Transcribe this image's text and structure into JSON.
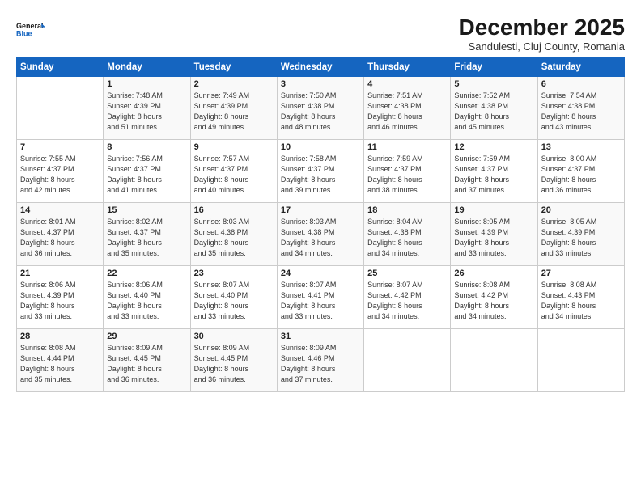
{
  "header": {
    "logo_line1": "General",
    "logo_line2": "Blue",
    "month": "December 2025",
    "location": "Sandulesti, Cluj County, Romania"
  },
  "days_of_week": [
    "Sunday",
    "Monday",
    "Tuesday",
    "Wednesday",
    "Thursday",
    "Friday",
    "Saturday"
  ],
  "weeks": [
    [
      {
        "day": "",
        "info": ""
      },
      {
        "day": "1",
        "info": "Sunrise: 7:48 AM\nSunset: 4:39 PM\nDaylight: 8 hours\nand 51 minutes."
      },
      {
        "day": "2",
        "info": "Sunrise: 7:49 AM\nSunset: 4:39 PM\nDaylight: 8 hours\nand 49 minutes."
      },
      {
        "day": "3",
        "info": "Sunrise: 7:50 AM\nSunset: 4:38 PM\nDaylight: 8 hours\nand 48 minutes."
      },
      {
        "day": "4",
        "info": "Sunrise: 7:51 AM\nSunset: 4:38 PM\nDaylight: 8 hours\nand 46 minutes."
      },
      {
        "day": "5",
        "info": "Sunrise: 7:52 AM\nSunset: 4:38 PM\nDaylight: 8 hours\nand 45 minutes."
      },
      {
        "day": "6",
        "info": "Sunrise: 7:54 AM\nSunset: 4:38 PM\nDaylight: 8 hours\nand 43 minutes."
      }
    ],
    [
      {
        "day": "7",
        "info": "Sunrise: 7:55 AM\nSunset: 4:37 PM\nDaylight: 8 hours\nand 42 minutes."
      },
      {
        "day": "8",
        "info": "Sunrise: 7:56 AM\nSunset: 4:37 PM\nDaylight: 8 hours\nand 41 minutes."
      },
      {
        "day": "9",
        "info": "Sunrise: 7:57 AM\nSunset: 4:37 PM\nDaylight: 8 hours\nand 40 minutes."
      },
      {
        "day": "10",
        "info": "Sunrise: 7:58 AM\nSunset: 4:37 PM\nDaylight: 8 hours\nand 39 minutes."
      },
      {
        "day": "11",
        "info": "Sunrise: 7:59 AM\nSunset: 4:37 PM\nDaylight: 8 hours\nand 38 minutes."
      },
      {
        "day": "12",
        "info": "Sunrise: 7:59 AM\nSunset: 4:37 PM\nDaylight: 8 hours\nand 37 minutes."
      },
      {
        "day": "13",
        "info": "Sunrise: 8:00 AM\nSunset: 4:37 PM\nDaylight: 8 hours\nand 36 minutes."
      }
    ],
    [
      {
        "day": "14",
        "info": "Sunrise: 8:01 AM\nSunset: 4:37 PM\nDaylight: 8 hours\nand 36 minutes."
      },
      {
        "day": "15",
        "info": "Sunrise: 8:02 AM\nSunset: 4:37 PM\nDaylight: 8 hours\nand 35 minutes."
      },
      {
        "day": "16",
        "info": "Sunrise: 8:03 AM\nSunset: 4:38 PM\nDaylight: 8 hours\nand 35 minutes."
      },
      {
        "day": "17",
        "info": "Sunrise: 8:03 AM\nSunset: 4:38 PM\nDaylight: 8 hours\nand 34 minutes."
      },
      {
        "day": "18",
        "info": "Sunrise: 8:04 AM\nSunset: 4:38 PM\nDaylight: 8 hours\nand 34 minutes."
      },
      {
        "day": "19",
        "info": "Sunrise: 8:05 AM\nSunset: 4:39 PM\nDaylight: 8 hours\nand 33 minutes."
      },
      {
        "day": "20",
        "info": "Sunrise: 8:05 AM\nSunset: 4:39 PM\nDaylight: 8 hours\nand 33 minutes."
      }
    ],
    [
      {
        "day": "21",
        "info": "Sunrise: 8:06 AM\nSunset: 4:39 PM\nDaylight: 8 hours\nand 33 minutes."
      },
      {
        "day": "22",
        "info": "Sunrise: 8:06 AM\nSunset: 4:40 PM\nDaylight: 8 hours\nand 33 minutes."
      },
      {
        "day": "23",
        "info": "Sunrise: 8:07 AM\nSunset: 4:40 PM\nDaylight: 8 hours\nand 33 minutes."
      },
      {
        "day": "24",
        "info": "Sunrise: 8:07 AM\nSunset: 4:41 PM\nDaylight: 8 hours\nand 33 minutes."
      },
      {
        "day": "25",
        "info": "Sunrise: 8:07 AM\nSunset: 4:42 PM\nDaylight: 8 hours\nand 34 minutes."
      },
      {
        "day": "26",
        "info": "Sunrise: 8:08 AM\nSunset: 4:42 PM\nDaylight: 8 hours\nand 34 minutes."
      },
      {
        "day": "27",
        "info": "Sunrise: 8:08 AM\nSunset: 4:43 PM\nDaylight: 8 hours\nand 34 minutes."
      }
    ],
    [
      {
        "day": "28",
        "info": "Sunrise: 8:08 AM\nSunset: 4:44 PM\nDaylight: 8 hours\nand 35 minutes."
      },
      {
        "day": "29",
        "info": "Sunrise: 8:09 AM\nSunset: 4:45 PM\nDaylight: 8 hours\nand 36 minutes."
      },
      {
        "day": "30",
        "info": "Sunrise: 8:09 AM\nSunset: 4:45 PM\nDaylight: 8 hours\nand 36 minutes."
      },
      {
        "day": "31",
        "info": "Sunrise: 8:09 AM\nSunset: 4:46 PM\nDaylight: 8 hours\nand 37 minutes."
      },
      {
        "day": "",
        "info": ""
      },
      {
        "day": "",
        "info": ""
      },
      {
        "day": "",
        "info": ""
      }
    ]
  ]
}
